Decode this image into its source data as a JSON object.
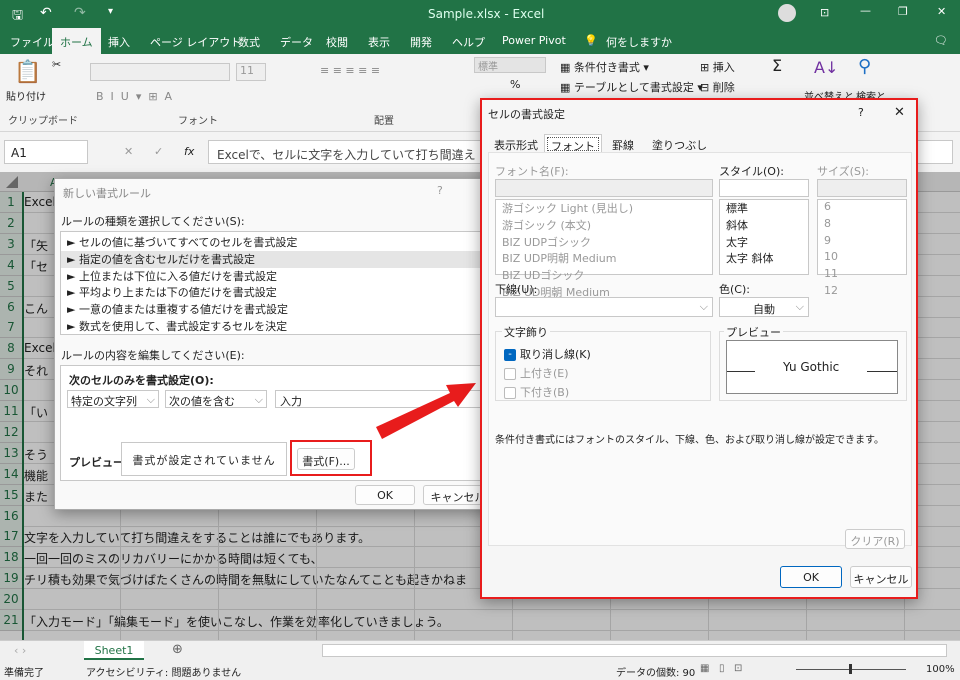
{
  "window": {
    "title": "Sample.xlsx - Excel",
    "controls": [
      "restore-ribbon",
      "minimize",
      "maximize",
      "close"
    ]
  },
  "menu": {
    "items": [
      "ファイル",
      "ホーム",
      "挿入",
      "ページ レイアウト",
      "数式",
      "データ",
      "校閲",
      "表示",
      "開発",
      "ヘルプ",
      "Power Pivot"
    ],
    "active": "ホーム",
    "tell_me": "何をしますか"
  },
  "ribbon": {
    "paste": "貼り付け",
    "clipboard": "クリップボード",
    "font_group": "フォント",
    "font_size": "11",
    "align_group": "配置",
    "number_format": "標準",
    "conditional": "条件付き書式",
    "table_format": "テーブルとして書式設定",
    "insert": "挿入",
    "delete": "削除",
    "sort": "並べ替えと",
    "find": "検索と"
  },
  "formula_bar": {
    "name_box": "A1",
    "content": "Excelで、セルに文字を入力していて打ち間違え"
  },
  "sheet": {
    "rows": [
      {
        "n": "1",
        "t": "Excel"
      },
      {
        "n": "2",
        "t": ""
      },
      {
        "n": "3",
        "t": "「矢"
      },
      {
        "n": "4",
        "t": "「セ"
      },
      {
        "n": "5",
        "t": ""
      },
      {
        "n": "6",
        "t": "こん"
      },
      {
        "n": "7",
        "t": ""
      },
      {
        "n": "8",
        "t": "Excel"
      },
      {
        "n": "9",
        "t": "それ"
      },
      {
        "n": "10",
        "t": ""
      },
      {
        "n": "11",
        "t": "「い"
      },
      {
        "n": "12",
        "t": ""
      },
      {
        "n": "13",
        "t": "そう"
      },
      {
        "n": "14",
        "t": "機能"
      },
      {
        "n": "15",
        "t": "また"
      },
      {
        "n": "16",
        "t": ""
      },
      {
        "n": "17",
        "t": "文字を入力していて打ち間違えをすることは誰にでもあります。"
      },
      {
        "n": "18",
        "t": "一回一回のミスのリカバリーにかかる時間は短くても、"
      },
      {
        "n": "19",
        "t": "チリ積も効果で気づけばたくさんの時間を無駄にしていたなんてことも起きかねま"
      },
      {
        "n": "20",
        "t": ""
      },
      {
        "n": "21",
        "t": "「入力モード」「編集モード」を使いこなし、作業を効率化していきましょう。"
      }
    ],
    "column_a": "A",
    "tab": "Sheet1"
  },
  "status": {
    "ready": "準備完了",
    "accessibility": "アクセシビリティ: 問題ありません",
    "count": "データの個数: 90",
    "zoom": "100%",
    "zoom_level": 100
  },
  "rule_dialog": {
    "title": "新しい書式ルール",
    "help": "?",
    "select_label": "ルールの種類を選択してください(S):",
    "rule_types": [
      "► セルの値に基づいてすべてのセルを書式設定",
      "► 指定の値を含むセルだけを書式設定",
      "► 上位または下位に入る値だけを書式設定",
      "► 平均より上または下の値だけを書式設定",
      "► 一意の値または重複する値だけを書式設定",
      "► 数式を使用して、書式設定するセルを決定"
    ],
    "selected_index": 1,
    "edit_label": "ルールの内容を編集してください(E):",
    "format_only": "次のセルのみを書式設定(O):",
    "condition1": "特定の文字列",
    "condition2": "次の値を含む",
    "value": "入力",
    "preview_label": "プレビュー:",
    "preview_text": "書式が設定されていません",
    "format_button": "書式(F)...",
    "ok": "OK",
    "cancel": "キャンセル"
  },
  "format_dialog": {
    "title": "セルの書式設定",
    "help": "?",
    "close": "X",
    "tabs": [
      "表示形式",
      "フォント",
      "罫線",
      "塗りつぶし"
    ],
    "active_tab": "フォント",
    "font_label": "フォント名(F):",
    "fonts": [
      "游ゴシック Light (見出し)",
      "游ゴシック (本文)",
      "BIZ UDPゴシック",
      "BIZ UDP明朝 Medium",
      "BIZ UDゴシック",
      "BIZ UD明朝 Medium"
    ],
    "style_label": "スタイル(O):",
    "styles": [
      "標準",
      "斜体",
      "太字",
      "太字 斜体"
    ],
    "size_label": "サイズ(S):",
    "sizes": [
      "6",
      "8",
      "9",
      "10",
      "11",
      "12"
    ],
    "underline_label": "下線(U):",
    "color_label": "色(C):",
    "color_value": "自動",
    "effects_label": "文字飾り",
    "strikethrough": "取り消し線(K)",
    "superscript": "上付き(E)",
    "subscript": "下付き(B)",
    "preview_label": "プレビュー",
    "preview_text": "Yu Gothic",
    "note": "条件付き書式にはフォントのスタイル、下線、色、および取り消し線が設定できます。",
    "clear": "クリア(R)",
    "ok": "OK",
    "cancel": "キャンセル"
  },
  "colors": {
    "excel_green": "#217346",
    "highlight_red": "#e81c1c",
    "accent_blue": "#0067c0"
  }
}
